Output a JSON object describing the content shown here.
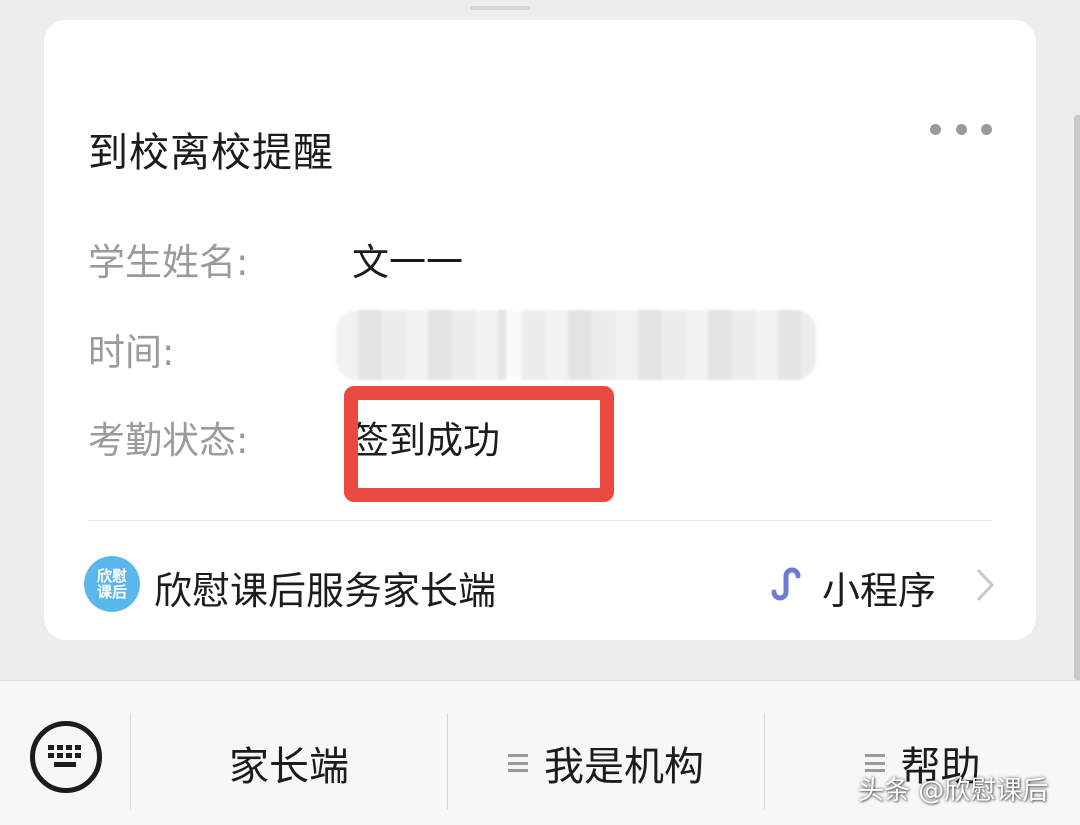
{
  "card": {
    "title": "到校离校提醒",
    "fields": [
      {
        "label": "学生姓名:",
        "value": "文一一"
      },
      {
        "label": "时间:",
        "value": ""
      },
      {
        "label": "考勤状态:",
        "value": "签到成功"
      }
    ]
  },
  "mini_program": {
    "logo_text_1": "欣慰",
    "logo_text_2": "课后",
    "name": "欣慰课后服务家长端",
    "type_label": "小程序"
  },
  "bottom_menu": {
    "items": [
      "家长端",
      "我是机构",
      "帮助"
    ]
  },
  "watermark": "头条 @欣慰课后",
  "colors": {
    "highlight": "#e84a3f",
    "logo_bg": "#59b7ec",
    "mini_icon": "#6f7bd0"
  },
  "icons": {
    "more": "ellipsis-icon",
    "keyboard": "keyboard-icon",
    "mini_program": "mini-program-icon",
    "chevron": "chevron-right-icon"
  }
}
